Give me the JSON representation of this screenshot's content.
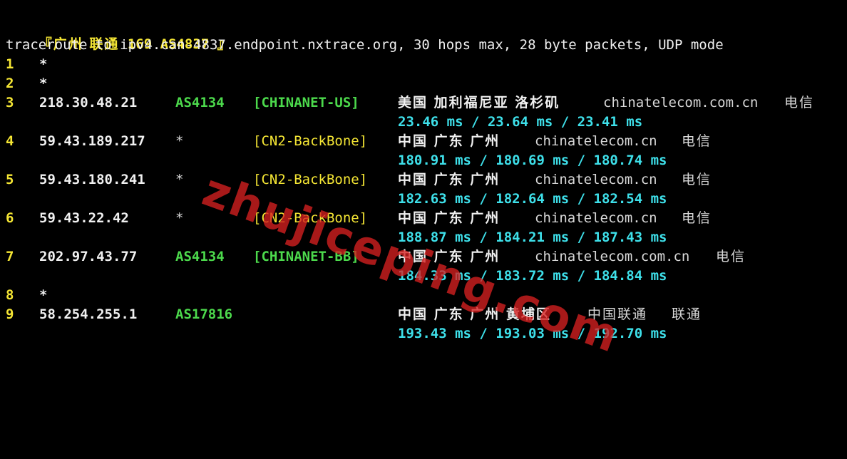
{
  "header": {
    "title_prefix": "『广州 联通",
    "title_suffix": "169 AS4837 』",
    "command": "traceroute to ipv4.can-4837.endpoint.nxtrace.org, 30 hops max, 28 byte packets, UDP mode"
  },
  "hops": [
    {
      "num": "1",
      "ip": "*"
    },
    {
      "num": "2",
      "ip": "*"
    },
    {
      "num": "3",
      "ip": "218.30.48.21",
      "asn": "AS4134",
      "tag": "[CHINANET-US]",
      "geo": "美国 加利福尼亚 洛杉矶",
      "domain": "chinatelecom.com.cn",
      "isp": "电信",
      "rtt": "23.46 ms / 23.64 ms / 23.41 ms"
    },
    {
      "num": "4",
      "ip": "59.43.189.217",
      "asn": "*",
      "tag": "[CN2-BackBone]",
      "geo": "中国 广东 广州",
      "domain": "chinatelecom.cn",
      "isp": "电信",
      "rtt": "180.91 ms / 180.69 ms / 180.74 ms"
    },
    {
      "num": "5",
      "ip": "59.43.180.241",
      "asn": "*",
      "tag": "[CN2-BackBone]",
      "geo": "中国 广东 广州",
      "domain": "chinatelecom.cn",
      "isp": "电信",
      "rtt": "182.63 ms / 182.64 ms / 182.54 ms"
    },
    {
      "num": "6",
      "ip": "59.43.22.42",
      "asn": "*",
      "tag": "[CN2-BackBone]",
      "geo": "中国 广东 广州",
      "domain": "chinatelecom.cn",
      "isp": "电信",
      "rtt": "188.87 ms / 184.21 ms / 187.43 ms"
    },
    {
      "num": "7",
      "ip": "202.97.43.77",
      "asn": "AS4134",
      "tag": "[CHINANET-BB]",
      "geo": "中国 广东 广州",
      "domain": "chinatelecom.com.cn",
      "isp": "电信",
      "rtt": "184.33 ms / 183.72 ms / 184.84 ms"
    },
    {
      "num": "8",
      "ip": "*"
    },
    {
      "num": "9",
      "ip": "58.254.255.1",
      "asn": "AS17816",
      "geo": "中国 广东 广州 黄埔区",
      "domain": "中国联通",
      "isp": "联通",
      "rtt": "193.43 ms / 193.03 ms / 192.70 ms"
    }
  ],
  "watermark": "zhujiceping.com",
  "colors": {
    "background": "#000000",
    "hop_number": "#f5e634",
    "asn": "#4cd94c",
    "tag": "#f5e634",
    "rtt": "#3ee0ea"
  }
}
